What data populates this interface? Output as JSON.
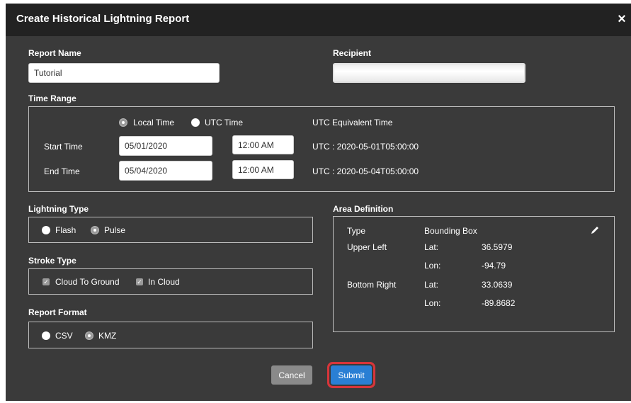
{
  "dialog": {
    "title": "Create Historical Lightning Report",
    "close_glyph": "×"
  },
  "report_name": {
    "label": "Report Name",
    "value": "Tutorial"
  },
  "recipient": {
    "label": "Recipient",
    "value": ""
  },
  "time_range": {
    "label": "Time Range",
    "local_time_label": "Local Time",
    "utc_time_label": "UTC Time",
    "selected": "Local Time",
    "utc_equivalent_header": "UTC Equivalent Time",
    "start_label": "Start Time",
    "start_date": "05/01/2020",
    "start_time": "12:00 AM",
    "start_utc": "UTC : 2020-05-01T05:00:00",
    "end_label": "End Time",
    "end_date": "05/04/2020",
    "end_time": "12:00 AM",
    "end_utc": "UTC : 2020-05-04T05:00:00"
  },
  "lightning_type": {
    "label": "Lightning Type",
    "options": [
      "Flash",
      "Pulse"
    ],
    "selected": "Pulse"
  },
  "stroke_type": {
    "label": "Stroke Type",
    "options": [
      "Cloud To Ground",
      "In Cloud"
    ],
    "checked": [
      "Cloud To Ground",
      "In Cloud"
    ],
    "check_glyph": "✓"
  },
  "report_format": {
    "label": "Report Format",
    "options": [
      "CSV",
      "KMZ"
    ],
    "selected": "KMZ"
  },
  "area_definition": {
    "label": "Area Definition",
    "type_label": "Type",
    "type_value": "Bounding Box",
    "upper_left_label": "Upper Left",
    "bottom_right_label": "Bottom Right",
    "lat_label": "Lat:",
    "lon_label": "Lon:",
    "upper_left_lat": "36.5979",
    "upper_left_lon": "-94.79",
    "bottom_right_lat": "33.0639",
    "bottom_right_lon": "-89.8682",
    "edit_icon": "pencil-icon"
  },
  "actions": {
    "cancel": "Cancel",
    "submit": "Submit"
  },
  "colors": {
    "dialog_bg": "#3a3a3a",
    "titlebar_bg": "#222222",
    "submit_bg": "#2a7fd4",
    "submit_highlight": "#d8353a",
    "cancel_bg": "#8a8a8a"
  }
}
